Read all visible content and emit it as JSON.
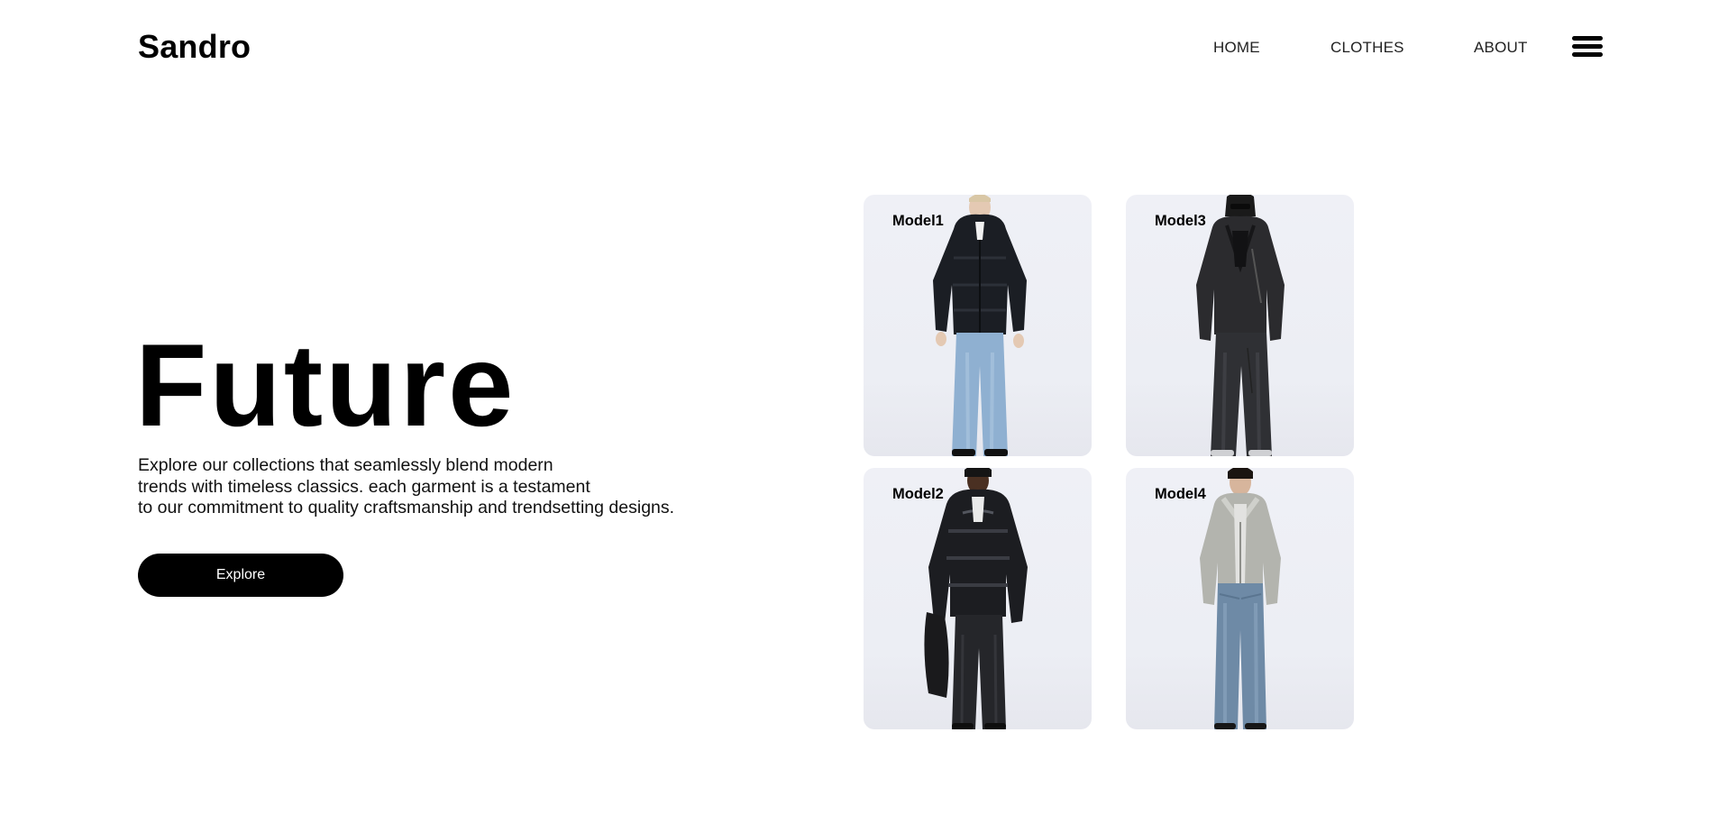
{
  "header": {
    "brand": "Sandro",
    "nav": {
      "home": "HOME",
      "clothes": "CLOTHES",
      "about": "ABOUT"
    },
    "menu_icon": "hamburger-menu-icon"
  },
  "hero": {
    "title": "Future",
    "description_lines": [
      "Explore our collections that seamlessly blend modern",
      "trends with timeless classics. each garment is a testament",
      "to our commitment to quality craftsmanship and trendsetting designs."
    ],
    "cta_label": "Explore"
  },
  "models": [
    {
      "label": "Model1"
    },
    {
      "label": "Model3"
    },
    {
      "label": "Model2"
    },
    {
      "label": "Model4"
    }
  ]
}
